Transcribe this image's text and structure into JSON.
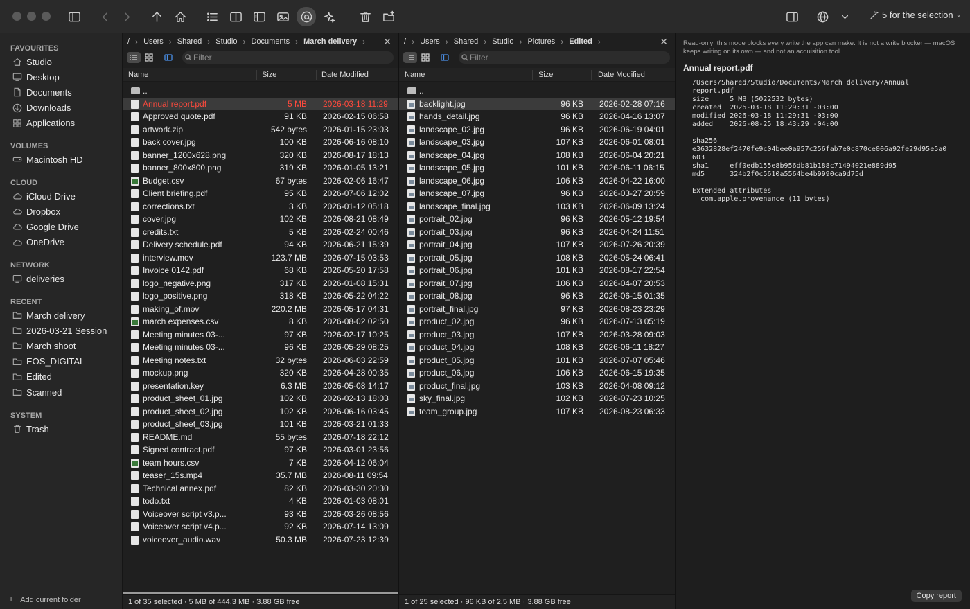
{
  "toolbar": {
    "selection_label": "5 for the selection",
    "icons": [
      "sidebar-toggle-icon",
      "back-icon",
      "forward-icon",
      "up-arrow-icon",
      "home-icon",
      "list-icon",
      "split-view-icon",
      "preview-pane-icon",
      "gallery-icon",
      "at-sign-icon",
      "sparkle-icon",
      "trash-icon",
      "new-folder-icon",
      "inspector-toggle-icon",
      "globe-icon",
      "chevron-down-icon",
      "wand-icon"
    ]
  },
  "sidebar": {
    "sections": [
      {
        "heading": "FAVOURITES",
        "items": [
          "Studio",
          "Desktop",
          "Documents",
          "Downloads",
          "Applications"
        ]
      },
      {
        "heading": "VOLUMES",
        "items": [
          "Macintosh HD"
        ]
      },
      {
        "heading": "CLOUD",
        "items": [
          "iCloud Drive",
          "Dropbox",
          "Google Drive",
          "OneDrive"
        ]
      },
      {
        "heading": "NETWORK",
        "items": [
          "deliveries"
        ]
      },
      {
        "heading": "RECENT",
        "items": [
          "March delivery",
          "2026-03-21 Session",
          "March shoot",
          "EOS_DIGITAL",
          "Edited",
          "Scanned"
        ]
      },
      {
        "heading": "SYSTEM",
        "items": [
          "Trash"
        ]
      }
    ],
    "add_folder": "Add current folder"
  },
  "left_pane": {
    "breadcrumb": [
      "/",
      "Users",
      "Shared",
      "Studio",
      "Documents",
      "March delivery"
    ],
    "filter_placeholder": "Filter",
    "columns": {
      "name": "Name",
      "size": "Size",
      "date": "Date Modified"
    },
    "parent": "..",
    "files": [
      {
        "name": "Annual report.pdf",
        "size": "5 MB",
        "date": "2026-03-18 11:29",
        "kind": "doc"
      },
      {
        "name": "Approved quote.pdf",
        "size": "91 KB",
        "date": "2026-02-15 06:58",
        "kind": "doc"
      },
      {
        "name": "artwork.zip",
        "size": "542 bytes",
        "date": "2026-01-15 23:03",
        "kind": "doc"
      },
      {
        "name": "back cover.jpg",
        "size": "100 KB",
        "date": "2026-06-16 08:10",
        "kind": "doc"
      },
      {
        "name": "banner_1200x628.png",
        "size": "320 KB",
        "date": "2026-08-17 18:13",
        "kind": "doc"
      },
      {
        "name": "banner_800x800.png",
        "size": "319 KB",
        "date": "2026-01-05 13:21",
        "kind": "doc"
      },
      {
        "name": "Budget.csv",
        "size": "67 bytes",
        "date": "2026-02-06 16:47",
        "kind": "csv"
      },
      {
        "name": "Client briefing.pdf",
        "size": "95 KB",
        "date": "2026-07-06 12:02",
        "kind": "doc"
      },
      {
        "name": "corrections.txt",
        "size": "3 KB",
        "date": "2026-01-12 05:18",
        "kind": "doc"
      },
      {
        "name": "cover.jpg",
        "size": "102 KB",
        "date": "2026-08-21 08:49",
        "kind": "doc"
      },
      {
        "name": "credits.txt",
        "size": "5 KB",
        "date": "2026-02-24 00:46",
        "kind": "doc"
      },
      {
        "name": "Delivery schedule.pdf",
        "size": "94 KB",
        "date": "2026-06-21 15:39",
        "kind": "doc"
      },
      {
        "name": "interview.mov",
        "size": "123.7 MB",
        "date": "2026-07-15 03:53",
        "kind": "doc"
      },
      {
        "name": "Invoice 0142.pdf",
        "size": "68 KB",
        "date": "2026-05-20 17:58",
        "kind": "doc"
      },
      {
        "name": "logo_negative.png",
        "size": "317 KB",
        "date": "2026-01-08 15:31",
        "kind": "doc"
      },
      {
        "name": "logo_positive.png",
        "size": "318 KB",
        "date": "2026-05-22 04:22",
        "kind": "doc"
      },
      {
        "name": "making_of.mov",
        "size": "220.2 MB",
        "date": "2026-05-17 04:31",
        "kind": "doc"
      },
      {
        "name": "march expenses.csv",
        "size": "8 KB",
        "date": "2026-08-02 02:50",
        "kind": "csv"
      },
      {
        "name": "Meeting minutes 03-...",
        "size": "97 KB",
        "date": "2026-02-17 10:25",
        "kind": "doc"
      },
      {
        "name": "Meeting minutes 03-...",
        "size": "96 KB",
        "date": "2026-05-29 08:25",
        "kind": "doc"
      },
      {
        "name": "Meeting notes.txt",
        "size": "32 bytes",
        "date": "2026-06-03 22:59",
        "kind": "doc"
      },
      {
        "name": "mockup.png",
        "size": "320 KB",
        "date": "2026-04-28 00:35",
        "kind": "doc"
      },
      {
        "name": "presentation.key",
        "size": "6.3 MB",
        "date": "2026-05-08 14:17",
        "kind": "doc"
      },
      {
        "name": "product_sheet_01.jpg",
        "size": "102 KB",
        "date": "2026-02-13 18:03",
        "kind": "doc"
      },
      {
        "name": "product_sheet_02.jpg",
        "size": "102 KB",
        "date": "2026-06-16 03:45",
        "kind": "doc"
      },
      {
        "name": "product_sheet_03.jpg",
        "size": "101 KB",
        "date": "2026-03-21 01:33",
        "kind": "doc"
      },
      {
        "name": "README.md",
        "size": "55 bytes",
        "date": "2026-07-18 22:12",
        "kind": "doc"
      },
      {
        "name": "Signed contract.pdf",
        "size": "97 KB",
        "date": "2026-03-01 23:56",
        "kind": "doc"
      },
      {
        "name": "team hours.csv",
        "size": "7 KB",
        "date": "2026-04-12 06:04",
        "kind": "csv"
      },
      {
        "name": "teaser_15s.mp4",
        "size": "35.7 MB",
        "date": "2026-08-11 09:54",
        "kind": "doc"
      },
      {
        "name": "Technical annex.pdf",
        "size": "82 KB",
        "date": "2026-03-30 20:30",
        "kind": "doc"
      },
      {
        "name": "todo.txt",
        "size": "4 KB",
        "date": "2026-01-03 08:01",
        "kind": "doc"
      },
      {
        "name": "Voiceover script v3.p...",
        "size": "93 KB",
        "date": "2026-03-26 08:56",
        "kind": "doc"
      },
      {
        "name": "Voiceover script v4.p...",
        "size": "92 KB",
        "date": "2026-07-14 13:09",
        "kind": "doc"
      },
      {
        "name": "voiceover_audio.wav",
        "size": "50.3 MB",
        "date": "2026-07-23 12:39",
        "kind": "doc"
      }
    ],
    "status": "1 of 35 selected · 5 MB of 444.3 MB · 3.88 GB free",
    "scroll_fraction": 1.0
  },
  "right_pane": {
    "breadcrumb": [
      "/",
      "Users",
      "Shared",
      "Studio",
      "Pictures",
      "Edited"
    ],
    "filter_placeholder": "Filter",
    "columns": {
      "name": "Name",
      "size": "Size",
      "date": "Date Modified"
    },
    "parent": "..",
    "files": [
      {
        "name": "backlight.jpg",
        "size": "96 KB",
        "date": "2026-02-28 07:16"
      },
      {
        "name": "hands_detail.jpg",
        "size": "96 KB",
        "date": "2026-04-16 13:07"
      },
      {
        "name": "landscape_02.jpg",
        "size": "96 KB",
        "date": "2026-06-19 04:01"
      },
      {
        "name": "landscape_03.jpg",
        "size": "107 KB",
        "date": "2026-06-01 08:01"
      },
      {
        "name": "landscape_04.jpg",
        "size": "108 KB",
        "date": "2026-06-04 20:21"
      },
      {
        "name": "landscape_05.jpg",
        "size": "101 KB",
        "date": "2026-06-11 06:15"
      },
      {
        "name": "landscape_06.jpg",
        "size": "106 KB",
        "date": "2026-04-22 16:00"
      },
      {
        "name": "landscape_07.jpg",
        "size": "96 KB",
        "date": "2026-03-27 20:59"
      },
      {
        "name": "landscape_final.jpg",
        "size": "103 KB",
        "date": "2026-06-09 13:24"
      },
      {
        "name": "portrait_02.jpg",
        "size": "96 KB",
        "date": "2026-05-12 19:54"
      },
      {
        "name": "portrait_03.jpg",
        "size": "96 KB",
        "date": "2026-04-24 11:51"
      },
      {
        "name": "portrait_04.jpg",
        "size": "107 KB",
        "date": "2026-07-26 20:39"
      },
      {
        "name": "portrait_05.jpg",
        "size": "108 KB",
        "date": "2026-05-24 06:41"
      },
      {
        "name": "portrait_06.jpg",
        "size": "101 KB",
        "date": "2026-08-17 22:54"
      },
      {
        "name": "portrait_07.jpg",
        "size": "106 KB",
        "date": "2026-04-07 20:53"
      },
      {
        "name": "portrait_08.jpg",
        "size": "96 KB",
        "date": "2026-06-15 01:35"
      },
      {
        "name": "portrait_final.jpg",
        "size": "97 KB",
        "date": "2026-08-23 23:29"
      },
      {
        "name": "product_02.jpg",
        "size": "96 KB",
        "date": "2026-07-13 05:19"
      },
      {
        "name": "product_03.jpg",
        "size": "107 KB",
        "date": "2026-03-28 09:03"
      },
      {
        "name": "product_04.jpg",
        "size": "108 KB",
        "date": "2026-06-11 18:27"
      },
      {
        "name": "product_05.jpg",
        "size": "101 KB",
        "date": "2026-07-07 05:46"
      },
      {
        "name": "product_06.jpg",
        "size": "106 KB",
        "date": "2026-06-15 19:35"
      },
      {
        "name": "product_final.jpg",
        "size": "103 KB",
        "date": "2026-04-08 09:12"
      },
      {
        "name": "sky_final.jpg",
        "size": "102 KB",
        "date": "2026-07-23 10:25"
      },
      {
        "name": "team_group.jpg",
        "size": "107 KB",
        "date": "2026-08-23 06:33"
      }
    ],
    "status": "1 of 25 selected · 96 KB of 2.5 MB · 3.88 GB free"
  },
  "info_panel": {
    "warning": "Read-only: this mode blocks every write the app can make. It is not a write blocker — macOS keeps writing on its own — and not an acquisition tool.",
    "title": "Annual report.pdf",
    "details": " /Users/Shared/Studio/Documents/March delivery/Annual\n report.pdf\n size     5 MB (5022532 bytes)\n created  2026-03-18 11:29:31 -03:00\n modified 2026-03-18 11:29:31 -03:00\n added    2026-08-25 18:43:29 -04:00\n\n sha256\n e3632828ef2470fe9c04bee0a957c256fab7e0c870ce006a92fe29d95e5a0\n 603\n sha1     eff0edb155e8b956db81b188c71494021e889d95\n md5      324b2f0c5610a5564be4b9990ca9d75d\n\n Extended attributes\n   com.apple.provenance (11 bytes)",
    "copy_button": "Copy report"
  },
  "colors": {
    "selected_red": "#ff4a3d",
    "selection_bg": "#3b3b3b"
  }
}
